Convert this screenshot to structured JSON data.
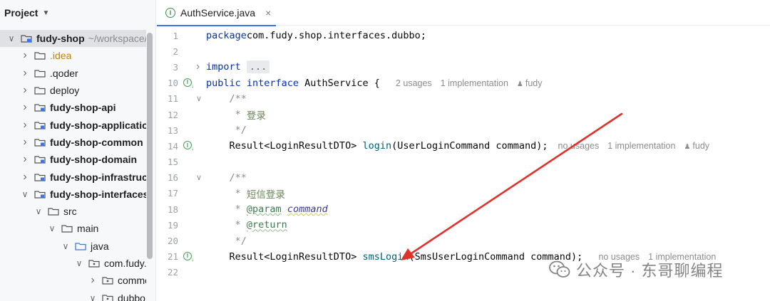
{
  "project_panel": {
    "title": "Project",
    "tree": [
      {
        "label": "fudy-shop",
        "hint": "~/workspace/f",
        "bold": true,
        "expanded": true,
        "selected": true,
        "kind": "module"
      },
      {
        "label": ".idea",
        "bold": false,
        "expanded": false,
        "kind": "folder",
        "orange": true
      },
      {
        "label": ".qoder",
        "bold": false,
        "expanded": false,
        "kind": "folder"
      },
      {
        "label": "deploy",
        "bold": false,
        "expanded": false,
        "kind": "folder"
      },
      {
        "label": "fudy-shop-api",
        "bold": true,
        "expanded": false,
        "kind": "module"
      },
      {
        "label": "fudy-shop-application",
        "bold": true,
        "expanded": false,
        "kind": "module"
      },
      {
        "label": "fudy-shop-common",
        "bold": true,
        "expanded": false,
        "kind": "module"
      },
      {
        "label": "fudy-shop-domain",
        "bold": true,
        "expanded": false,
        "kind": "module"
      },
      {
        "label": "fudy-shop-infrastruct",
        "bold": true,
        "expanded": false,
        "kind": "module"
      },
      {
        "label": "fudy-shop-interfaces",
        "bold": true,
        "expanded": true,
        "kind": "module"
      },
      {
        "label": "src",
        "bold": false,
        "expanded": true,
        "kind": "folder"
      },
      {
        "label": "main",
        "bold": false,
        "expanded": true,
        "kind": "folder"
      },
      {
        "label": "java",
        "bold": false,
        "expanded": true,
        "kind": "source"
      },
      {
        "label": "com.fudy.s",
        "bold": false,
        "expanded": true,
        "kind": "package"
      },
      {
        "label": "commo",
        "bold": false,
        "expanded": false,
        "kind": "package"
      },
      {
        "label": "dubbo",
        "bold": false,
        "expanded": true,
        "kind": "package"
      }
    ]
  },
  "editor": {
    "tab_label": "AuthService.java",
    "tab_icon": "interface-icon",
    "close_glyph": "×",
    "lines": [
      {
        "num": "1",
        "tokens": [
          [
            "kw",
            "package"
          ],
          [
            "",
            "com.fudy.shop.interfaces.dubbo;"
          ]
        ]
      },
      {
        "num": "2",
        "tokens": []
      },
      {
        "num": "3",
        "fold": ">",
        "tokens": [
          [
            "kw",
            "import "
          ],
          [
            "folded",
            "..."
          ]
        ]
      },
      {
        "num": "10",
        "impl": true,
        "tokens": [
          [
            "kw",
            "public interface "
          ],
          [
            "",
            "AuthService { "
          ]
        ],
        "inlays": [
          "2 usages",
          "1 implementation",
          "fudy"
        ]
      },
      {
        "num": "11",
        "fold": "v",
        "tokens": [
          [
            "cm",
            "    /**"
          ]
        ]
      },
      {
        "num": "12",
        "tokens": [
          [
            "cm",
            "     * "
          ],
          [
            "cm-cn",
            "登录"
          ]
        ]
      },
      {
        "num": "13",
        "tokens": [
          [
            "cm",
            "     */"
          ]
        ]
      },
      {
        "num": "14",
        "impl": true,
        "tokens": [
          [
            "",
            "    Result<LoginResultDTO> "
          ],
          [
            "fn",
            "login"
          ],
          [
            "",
            "(UserLoginCommand command);"
          ]
        ],
        "inlays": [
          "no usages",
          "1 implementation",
          "fudy"
        ]
      },
      {
        "num": "15",
        "tokens": []
      },
      {
        "num": "16",
        "fold": "v",
        "tokens": [
          [
            "cm",
            "    /**"
          ]
        ]
      },
      {
        "num": "17",
        "tokens": [
          [
            "cm",
            "     * "
          ],
          [
            "cm-cn",
            "短信登录"
          ]
        ]
      },
      {
        "num": "18",
        "tokens": [
          [
            "cm",
            "     * "
          ],
          [
            "tag",
            "@param"
          ],
          [
            "cm",
            " "
          ],
          [
            "param",
            "command"
          ]
        ]
      },
      {
        "num": "19",
        "tokens": [
          [
            "cm",
            "     * "
          ],
          [
            "tag",
            "@return"
          ]
        ]
      },
      {
        "num": "20",
        "tokens": [
          [
            "cm",
            "     */"
          ]
        ]
      },
      {
        "num": "21",
        "impl": true,
        "tokens": [
          [
            "",
            "    Result<LoginResultDTO> "
          ],
          [
            "fn",
            "smsLogin"
          ],
          [
            "",
            "(SmsUserLoginCommand command); "
          ]
        ],
        "inlays": [
          "no usages",
          "1 implementation"
        ]
      },
      {
        "num": "22",
        "tokens": []
      }
    ]
  },
  "watermark": {
    "text": "公众号 · 东哥聊编程"
  },
  "colors": {
    "accent": "#3574f0",
    "annotation_arrow": "#e0322b",
    "keyword": "#0033b3",
    "method": "#00627a",
    "comment": "#8c8c8c"
  }
}
